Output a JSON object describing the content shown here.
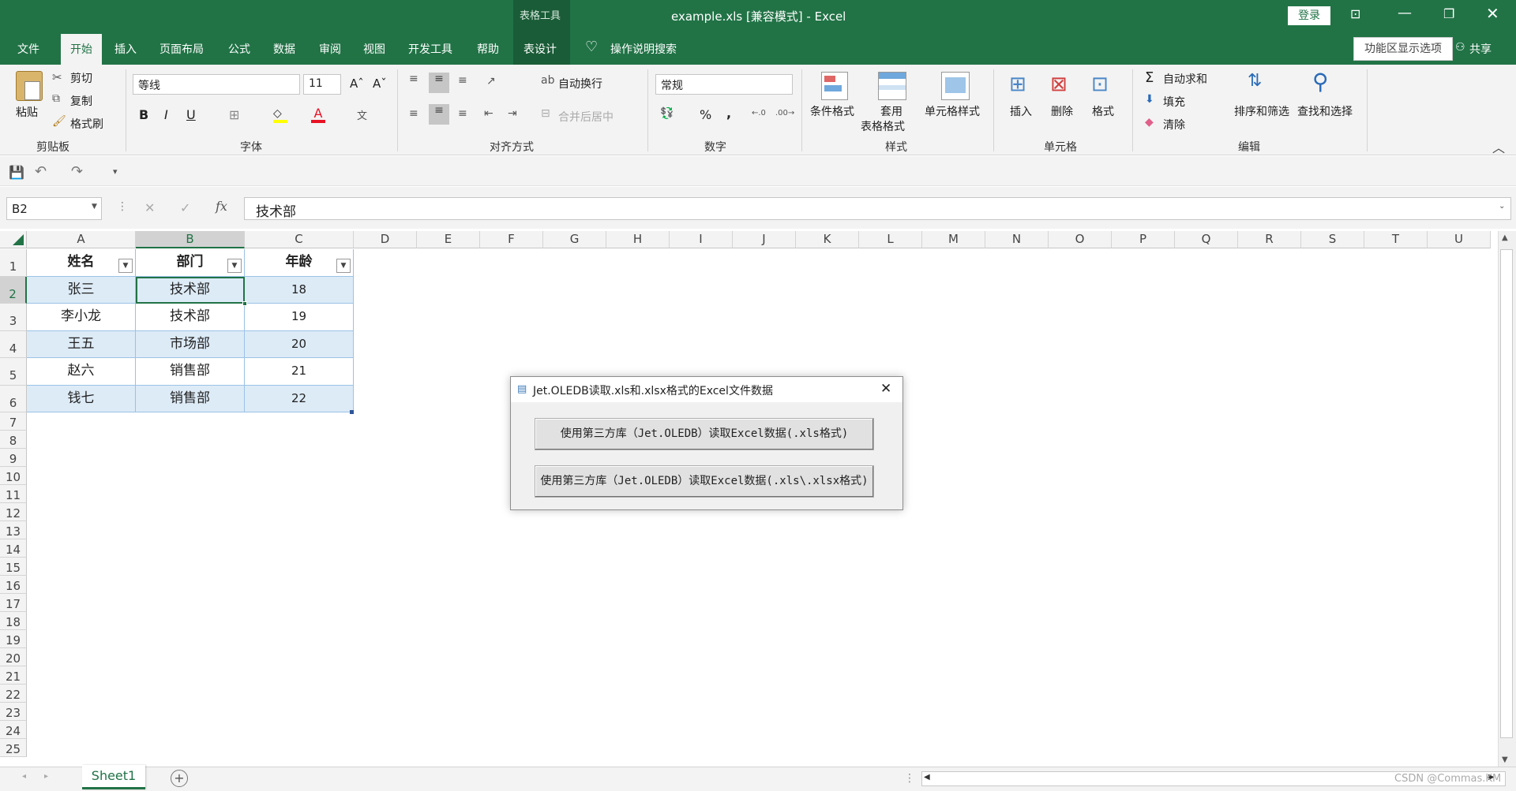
{
  "window": {
    "title": "example.xls  [兼容模式]  -  Excel",
    "context_tab": "表格工具",
    "login": "登录",
    "ribbon_display_options": "功能区显示选项",
    "share": "共享"
  },
  "tabs": [
    "文件",
    "开始",
    "插入",
    "页面布局",
    "公式",
    "数据",
    "审阅",
    "视图",
    "开发工具",
    "帮助",
    "表设计"
  ],
  "tell_me": "操作说明搜索",
  "ribbon": {
    "clipboard": {
      "paste": "粘贴",
      "cut": "剪切",
      "copy": "复制",
      "format_painter": "格式刷",
      "group": "剪贴板"
    },
    "font": {
      "name": "等线",
      "size": "11",
      "bold": "B",
      "italic": "I",
      "underline": "U",
      "group": "字体"
    },
    "alignment": {
      "wrap": "自动换行",
      "merge": "合并后居中",
      "group": "对齐方式"
    },
    "number": {
      "format": "常规",
      "percent": "%",
      "comma": ",",
      "group": "数字"
    },
    "styles": {
      "conditional": "条件格式",
      "table_format_1": "套用",
      "table_format_2": "表格格式",
      "cell_styles": "单元格样式",
      "group": "样式"
    },
    "cells": {
      "insert": "插入",
      "delete": "删除",
      "format": "格式",
      "group": "单元格"
    },
    "editing": {
      "autosum": "自动求和",
      "fill": "填充",
      "clear": "清除",
      "sort": "排序和筛选",
      "find": "查找和选择",
      "group": "编辑"
    }
  },
  "formula_bar": {
    "name_box": "B2",
    "fx": "fx",
    "value": "技术部"
  },
  "columns": [
    "A",
    "B",
    "C",
    "D",
    "E",
    "F",
    "G",
    "H",
    "I",
    "J",
    "K",
    "L",
    "M",
    "N",
    "O",
    "P",
    "Q",
    "R",
    "S",
    "T",
    "U"
  ],
  "rows": [
    "1",
    "2",
    "3",
    "4",
    "5",
    "6",
    "7",
    "8",
    "9",
    "10",
    "11",
    "12",
    "13",
    "14",
    "15",
    "16",
    "17",
    "18",
    "19",
    "20",
    "21",
    "22",
    "23",
    "24",
    "25"
  ],
  "table": {
    "headers": [
      "姓名",
      "部门",
      "年龄"
    ],
    "data": [
      [
        "张三",
        "技术部",
        "18"
      ],
      [
        "李小龙",
        "技术部",
        "19"
      ],
      [
        "王五",
        "市场部",
        "20"
      ],
      [
        "赵六",
        "销售部",
        "21"
      ],
      [
        "钱七",
        "销售部",
        "22"
      ]
    ]
  },
  "dialog": {
    "title": "Jet.OLEDB读取.xls和.xlsx格式的Excel文件数据",
    "button1": "使用第三方库（Jet.OLEDB）读取Excel数据(.xls格式)",
    "button2": "使用第三方库（Jet.OLEDB）读取Excel数据(.xls\\.xlsx格式)"
  },
  "sheet_tab": "Sheet1",
  "watermark": "CSDN @Commas.KM",
  "colors": {
    "excel_green": "#217346",
    "table_band": "#ddebf7",
    "table_border": "#9bc2e6"
  }
}
